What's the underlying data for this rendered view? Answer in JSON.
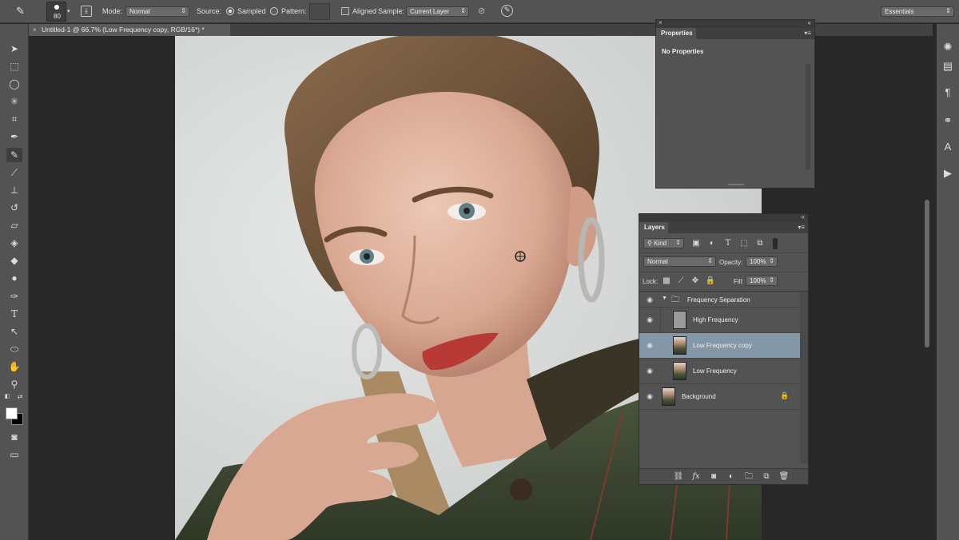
{
  "options_bar": {
    "brush_size": "80",
    "mode_label": "Mode:",
    "mode_value": "Normal",
    "source_label": "Source:",
    "sampled_label": "Sampled",
    "pattern_label": "Pattern:",
    "aligned_label": "Aligned",
    "sample_label": "Sample:",
    "sample_value": "Current Layer",
    "workspace": "Essentials"
  },
  "document_tab": {
    "title": "Untitled-1 @ 66.7% (Low Frequency copy, RGB/16*) *"
  },
  "toolbar": {
    "tools": [
      {
        "name": "move-tool",
        "glyph": "➤"
      },
      {
        "name": "marquee-tool",
        "glyph": "⬚"
      },
      {
        "name": "lasso-tool",
        "glyph": "◯"
      },
      {
        "name": "magic-wand-tool",
        "glyph": "✳"
      },
      {
        "name": "crop-tool",
        "glyph": "⌗"
      },
      {
        "name": "eyedropper-tool",
        "glyph": "✒"
      },
      {
        "name": "healing-brush-tool",
        "glyph": "✎"
      },
      {
        "name": "brush-tool",
        "glyph": "🖌"
      },
      {
        "name": "clone-stamp-tool",
        "glyph": "⊥"
      },
      {
        "name": "history-brush-tool",
        "glyph": "↺"
      },
      {
        "name": "eraser-tool",
        "glyph": "▱"
      },
      {
        "name": "paint-bucket-tool",
        "glyph": "◈"
      },
      {
        "name": "blur-tool",
        "glyph": "💧"
      },
      {
        "name": "dodge-tool",
        "glyph": "●"
      },
      {
        "name": "pen-tool",
        "glyph": "✑"
      },
      {
        "name": "type-tool",
        "glyph": "T"
      },
      {
        "name": "path-selection-tool",
        "glyph": "↖"
      },
      {
        "name": "ellipse-tool",
        "glyph": "⬭"
      },
      {
        "name": "hand-tool",
        "glyph": "✋"
      },
      {
        "name": "zoom-tool",
        "glyph": "🔍"
      }
    ]
  },
  "properties_panel": {
    "tab": "Properties",
    "message": "No Properties"
  },
  "layers_panel": {
    "tab": "Layers",
    "filter_kind": "Kind",
    "blend_mode": "Normal",
    "opacity_label": "Opacity:",
    "opacity_value": "100%",
    "lock_label": "Lock:",
    "fill_label": "Fill:",
    "fill_value": "100%",
    "layers": [
      {
        "name": "Frequency Separation",
        "type": "group"
      },
      {
        "name": "High Frequency",
        "type": "layer"
      },
      {
        "name": "Low Frequency copy",
        "type": "layer",
        "selected": true
      },
      {
        "name": "Low Frequency",
        "type": "layer"
      },
      {
        "name": "Background",
        "type": "background",
        "locked": true
      }
    ]
  },
  "colors": {
    "ui_bg": "#535353",
    "selection": "#8497a8",
    "workspace_bg": "#282828"
  }
}
